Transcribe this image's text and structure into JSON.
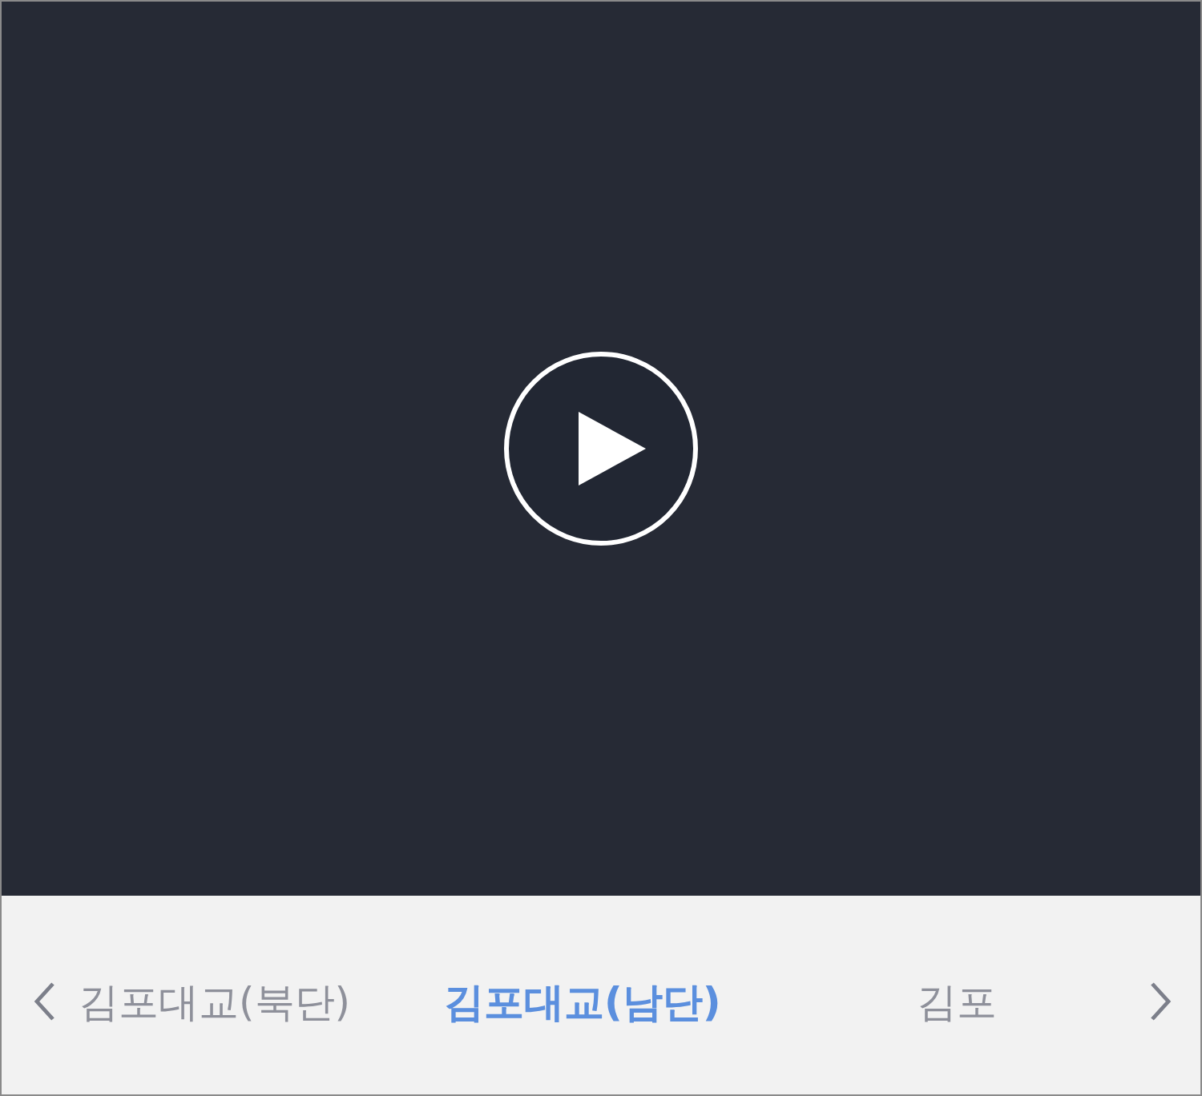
{
  "video": {
    "playing": false
  },
  "cameras": [
    {
      "label": "김포대교(북단)",
      "selected": false
    },
    {
      "label": "김포대교(남단)",
      "selected": true
    },
    {
      "label": "김포",
      "selected": false
    }
  ]
}
